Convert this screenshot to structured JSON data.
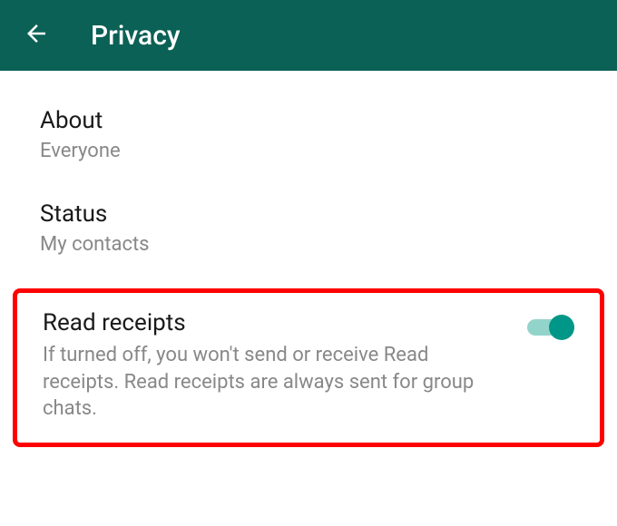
{
  "header": {
    "title": "Privacy"
  },
  "settings": {
    "about": {
      "title": "About",
      "value": "Everyone"
    },
    "status": {
      "title": "Status",
      "value": "My contacts"
    },
    "readReceipts": {
      "title": "Read receipts",
      "description": "If turned off, you won't send or receive Read receipts. Read receipts are always sent for group chats.",
      "enabled": true
    }
  },
  "colors": {
    "headerBg": "#0b6156",
    "toggleOn": "#009688",
    "toggleTrack": "#93d4ca",
    "highlight": "#ff0000"
  }
}
